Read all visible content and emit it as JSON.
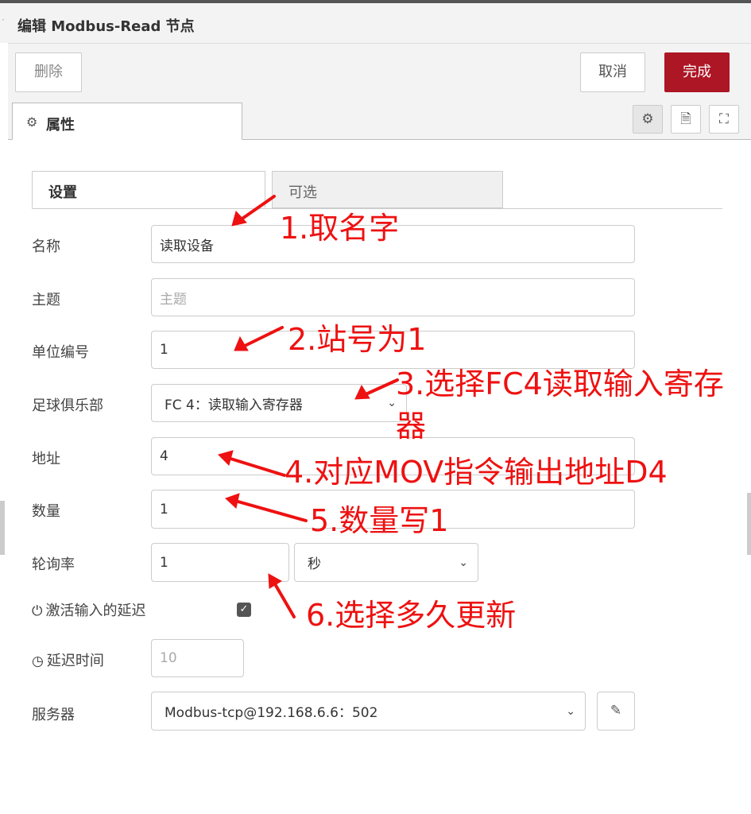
{
  "header": {
    "title": "编辑 Modbus-Read 节点"
  },
  "toolbar": {
    "delete_label": "删除",
    "cancel_label": "取消",
    "done_label": "完成"
  },
  "tabs": {
    "properties_label": "属性"
  },
  "subtabs": {
    "settings_label": "设置",
    "optional_label": "可选"
  },
  "form": {
    "name": {
      "label": "名称",
      "value": "读取设备"
    },
    "topic": {
      "label": "主题",
      "placeholder": "主题"
    },
    "unit_id": {
      "label": "单位编号",
      "value": "1"
    },
    "fc": {
      "label": "足球俱乐部",
      "value": "FC 4：读取输入寄存器"
    },
    "address": {
      "label": "地址",
      "value": "4"
    },
    "quantity": {
      "label": "数量",
      "value": "1"
    },
    "poll_rate": {
      "label": "轮询率",
      "value": "1",
      "unit": "秒"
    },
    "delay_on_start": {
      "label": "激活输入的延迟",
      "checked": true
    },
    "start_delay_time": {
      "label": "延迟时间",
      "placeholder": "10"
    },
    "server": {
      "label": "服务器",
      "value": "Modbus-tcp@192.168.6.6：502"
    }
  },
  "annotations": {
    "a1": "1.取名字",
    "a2": "2.站号为1",
    "a3_line1": "3.选择FC4读取输入寄存",
    "a3_line2": "器",
    "a4": "4.对应MOV指令输出地址D4",
    "a5": "5.数量写1",
    "a6": "6.选择多久更新"
  },
  "colors": {
    "accent": "#ad1625",
    "annotation": "#ee1111"
  }
}
